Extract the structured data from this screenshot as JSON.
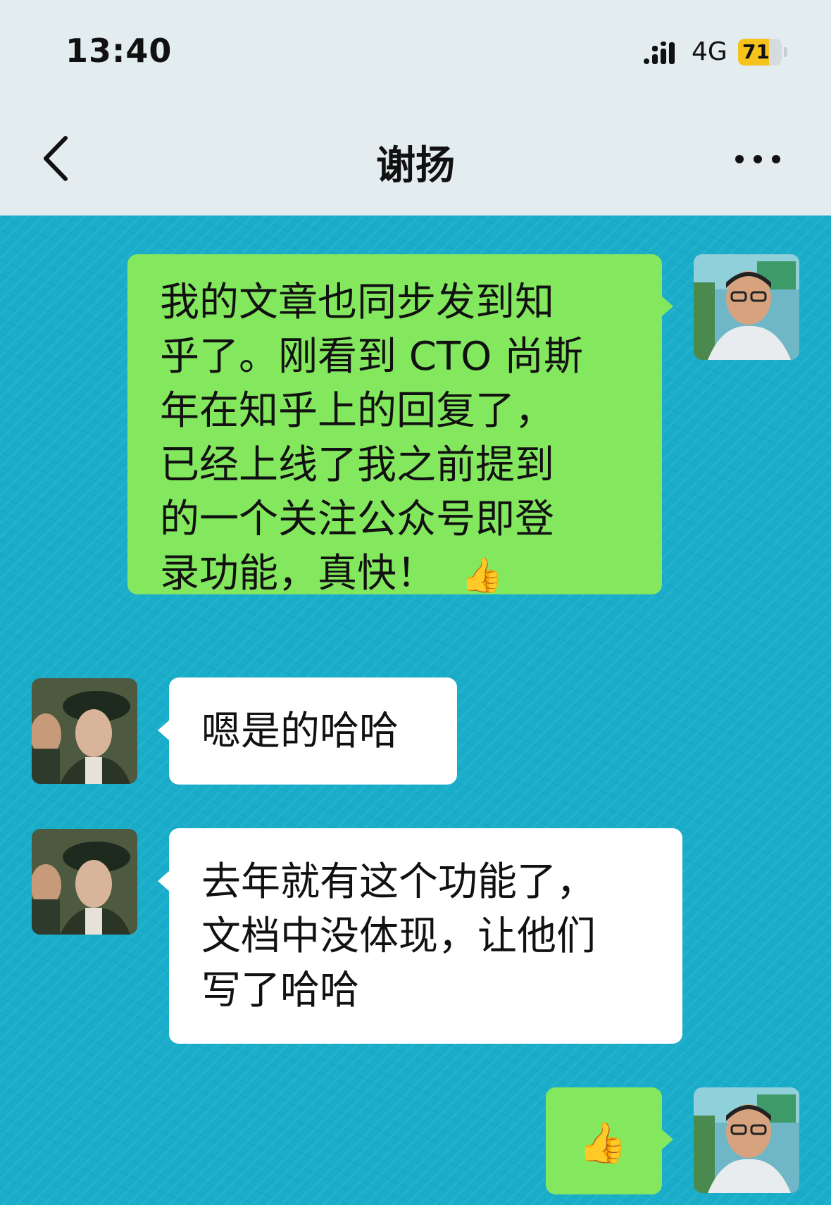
{
  "status_bar": {
    "time": "13:40",
    "network": "4G",
    "battery": "71",
    "battery_level": 0.71,
    "signal_icon": "signal-bars-icon",
    "charging_icon": "lightning-icon"
  },
  "nav": {
    "title": "谢扬",
    "back_icon": "chevron-left-icon",
    "more_icon": "more-dots-icon"
  },
  "colors": {
    "chat_background": "#19adc9",
    "my_bubble": "#84e85f",
    "other_bubble": "#ffffff"
  },
  "messages": [
    {
      "sender": "me",
      "lines": [
        "我的文章也同步发到知",
        "乎了。刚看到 CTO 尚斯",
        "年在知乎上的回复了，",
        "已经上线了我之前提到",
        "的一个关注公众号即登",
        "录功能，真快！"
      ],
      "emoji": "👍"
    },
    {
      "sender": "other",
      "lines": [
        "嗯是的哈哈"
      ]
    },
    {
      "sender": "other",
      "lines": [
        "去年就有这个功能了，",
        "文档中没体现，让他们",
        "写了哈哈"
      ]
    },
    {
      "sender": "me",
      "lines": [],
      "emoji": "👍"
    }
  ]
}
